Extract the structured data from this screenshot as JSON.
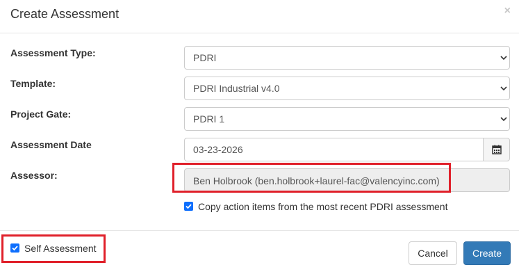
{
  "dialog": {
    "title": "Create Assessment",
    "close_glyph": "×"
  },
  "form": {
    "assessment_type": {
      "label": "Assessment Type:",
      "value": "PDRI"
    },
    "template": {
      "label": "Template:",
      "value": "PDRI Industrial v4.0"
    },
    "project_gate": {
      "label": "Project Gate:",
      "value": "PDRI 1"
    },
    "assessment_date": {
      "label": "Assessment Date",
      "value": "03-23-2026",
      "icon": "calendar-icon"
    },
    "assessor": {
      "label": "Assessor:",
      "value": "Ben Holbrook (ben.holbrook+laurel-fac@valencyinc.com)"
    },
    "copy_action_items": {
      "label": "Copy action items from the most recent PDRI assessment",
      "checked": true
    }
  },
  "footer": {
    "self_assessment": {
      "label": "Self Assessment",
      "checked": true
    },
    "cancel_label": "Cancel",
    "create_label": "Create"
  },
  "colors": {
    "primary": "#337ab7",
    "highlight": "#e0202a",
    "checkbox": "#0d6efd"
  }
}
